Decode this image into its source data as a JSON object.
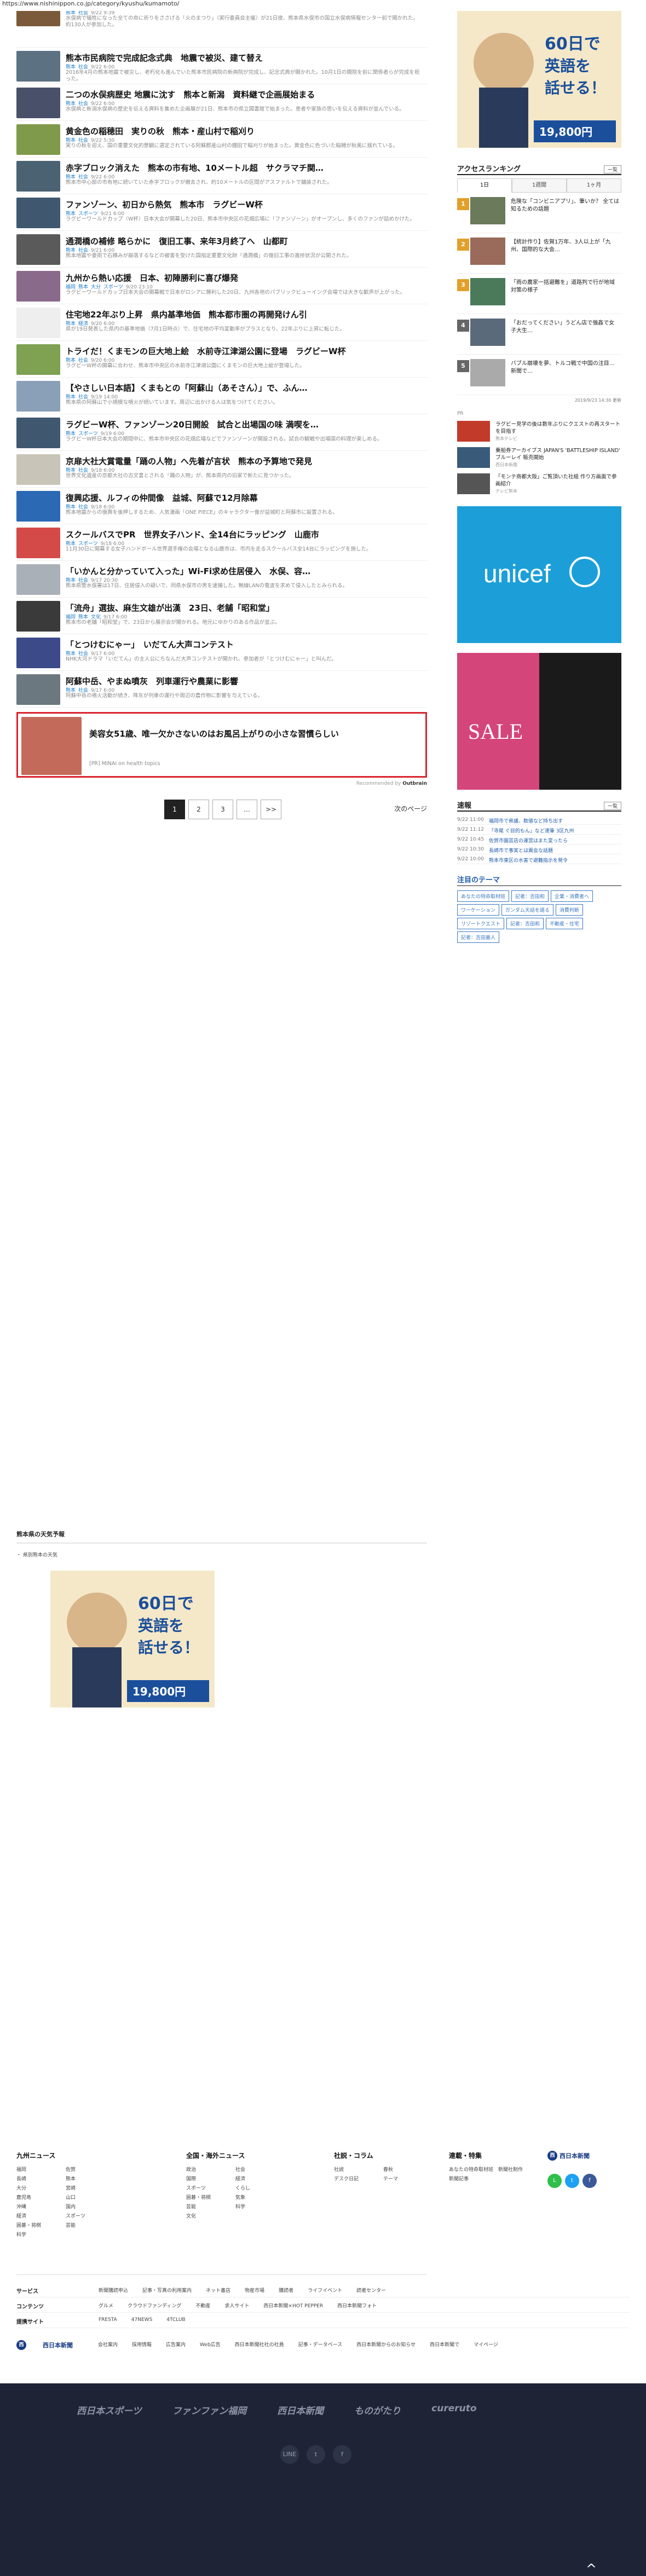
{
  "url": "https://www.nishinippon.co.jp/category/kyushu/kumamoto/",
  "articles": [
    {
      "title": "",
      "tags": [
        "熊本",
        "社会"
      ],
      "date": "9/22 9:39",
      "excerpt": "水俣病で犠牲になった全ての命に祈りをささげる「火のまつり」（実行委員会主催）が21日夜、熊本県水俣市の国立水俣病情報センター前で開かれた。約130人が参加した。",
      "color": "#7a5a3a"
    },
    {
      "title": "熊本市民病院で完成記念式典　地震で被災、建て替え",
      "tags": [
        "熊本",
        "社会"
      ],
      "date": "9/22 6:00",
      "excerpt": "2016年4月の熊本地震で被災し、老朽化も進んでいた熊本市民病院の新病院が完成し、記念式典が開かれた。10月1日の開院を前に関係者らが完成を祝った。",
      "color": "#5c7182"
    },
    {
      "title": "二つの水俣病歴史 地震に沈す　熊本と新潟　資料継で企画展始まる",
      "tags": [
        "熊本",
        "社会"
      ],
      "date": "9/22 6:00",
      "excerpt": "水俣病と新潟水俣病の歴史を伝える資料を集めた企画展が21日、熊本市の県立図書館で始まった。患者や家族の思いを伝える資料が並んでいる。",
      "color": "#49506a"
    },
    {
      "title": "黄金色の稲穂田　実りの秋　熊本・産山村で稲刈り",
      "tags": [
        "熊本",
        "社会"
      ],
      "date": "9/22 5:30",
      "excerpt": "実りの秋を迎え、国の重要文化的景観に選定されている阿蘇郡産山村の棚田で稲刈りが始まった。黄金色に色づいた稲穂が秋風に揺れている。",
      "color": "#7f9a4a"
    },
    {
      "title": "赤字ブロック消えた　熊本の市有地、10メートル超　サクラマチ関…",
      "tags": [
        "熊本",
        "社会"
      ],
      "date": "9/22 6:00",
      "excerpt": "熊本市中心部の市有地に続いていた赤字ブロックが撤去され、約10メートルの区間がアスファルトで舗装された。",
      "color": "#4b6272"
    },
    {
      "title": "ファンゾーン、初日から熱気　熊本市　ラグビーW杯",
      "tags": [
        "熊本",
        "スポーツ"
      ],
      "date": "9/21 6:00",
      "excerpt": "ラグビーワールドカップ（W杯）日本大会が開幕した20日、熊本市中央区の花畑広場に「ファンゾーン」がオープンし、多くのファンが詰めかけた。",
      "color": "#3f5870"
    },
    {
      "title": "通潤橋の補修 略らかに　復旧工事、来年3月終了へ　山都町",
      "tags": [
        "熊本",
        "社会"
      ],
      "date": "9/21 6:00",
      "excerpt": "熊本地震や豪雨で石積みが崩落するなどの被害を受けた国指定重要文化財「通潤橋」の復旧工事の進捗状況が公開された。",
      "color": "#5a5a5a"
    },
    {
      "title": "九州から熱い応援　日本、初陣勝利に喜び爆発",
      "tags": [
        "福岡",
        "熊本",
        "大分",
        "スポーツ"
      ],
      "date": "9/20 23:10",
      "excerpt": "ラグビーワールドカップ日本大会の開幕戦で日本がロシアに勝利した20日、九州各地のパブリックビューイング会場では大きな歓声が上がった。",
      "color": "#8a6a8a"
    },
    {
      "title": "住宅地22年ぶり上昇　県内基準地価　熊本都市圏の再開発けん引",
      "tags": [
        "熊本",
        "経済"
      ],
      "date": "9/20 6:00",
      "excerpt": "県が19日発表した県内の基準地価（7月1日時点）で、住宅地の平均変動率がプラスとなり、22年ぶりに上昇に転じた。",
      "color": "#eeeeee"
    },
    {
      "title": "トライだ！くまモンの巨大地上絵　水前寺江津湖公園に登場　ラグビーW杯",
      "tags": [
        "熊本",
        "社会"
      ],
      "date": "9/20 6:00",
      "excerpt": "ラグビーW杯の開幕に合わせ、熊本市中央区の水前寺江津湖公園にくまモンの巨大地上絵が登場した。",
      "color": "#7fa152"
    },
    {
      "title": "【やさしい日本語】くまもとの「阿蘇山（あそさん）」で、ふん…",
      "tags": [
        "熊本",
        "社会"
      ],
      "date": "9/19 14:00",
      "excerpt": "熊本県の阿蘇山で小規模な噴火が続いています。周辺に出かける人は気をつけてください。",
      "color": "#8a9fb8"
    },
    {
      "title": "ラグビーW杯、ファンゾーン20日開設　試合と出場国の味 満喫を…",
      "tags": [
        "熊本",
        "スポーツ"
      ],
      "date": "9/19 6:00",
      "excerpt": "ラグビーW杯日本大会の期間中に、熊本市中央区の花畑広場などでファンゾーンが開設される。試合の観戦や出場国の料理が楽しめる。",
      "color": "#3f5870"
    },
    {
      "title": "京扉大社大賞電量「踊の人物」へ先着が言状　熊本の予算地で発見",
      "tags": [
        "熊本",
        "社会"
      ],
      "date": "9/18 6:00",
      "excerpt": "世界文化遺産の京都大社の古文書とされる「踊の人物」が、熊本県内の旧家で新たに見つかった。",
      "color": "#c9c4b8"
    },
    {
      "title": "復興応援、ルフィの仲間像　益城、阿蘇で12月除幕",
      "tags": [
        "熊本",
        "社会"
      ],
      "date": "9/18 6:00",
      "excerpt": "熊本地震からの復興を後押しするため、人気漫画「ONE PIECE」のキャラクター像が益城町と阿蘇市に設置される。",
      "color": "#2b69b5"
    },
    {
      "title": "スクールバスでPR　世界女子ハンド、全14台にラッピング　山鹿市",
      "tags": [
        "熊本",
        "スポーツ"
      ],
      "date": "9/18 6:00",
      "excerpt": "11月30日に開幕する女子ハンドボール世界選手権の会場となる山鹿市は、市内を走るスクールバス全14台にラッピングを施した。",
      "color": "#d34a48"
    },
    {
      "title": "「いかんと分かっていて入った」Wi-Fi求め住居侵入　水俣、容…",
      "tags": [
        "熊本",
        "社会"
      ],
      "date": "9/17 20:30",
      "excerpt": "熊本県警水俣署は17日、住居侵入の疑いで、同県水俣市の男を逮捕した。無線LANの電波を求めて侵入したとみられる。",
      "color": "#aab0b8"
    },
    {
      "title": "「流舟」選抜、麻生文雄が出漢　23日、老舗「昭和堂」",
      "tags": [
        "福岡",
        "熊本",
        "文化"
      ],
      "date": "9/17 6:00",
      "excerpt": "熊本市の老舗「昭和堂」で、23日から展示会が開かれる。地元にゆかりのある作品が並ぶ。",
      "color": "#3a3a3a"
    },
    {
      "title": "「とつけむにゃー」　いだてん大声コンテスト",
      "tags": [
        "熊本",
        "社会"
      ],
      "date": "9/17 6:00",
      "excerpt": "NHK大河ドラマ「いだてん」の主人公にちなんだ大声コンテストが開かれ、参加者が「とつけむにゃー」と叫んだ。",
      "color": "#3d4a8a"
    },
    {
      "title": "阿蘇中岳、やまぬ噴灰　列車運行や農業に影響",
      "tags": [
        "熊本",
        "社会"
      ],
      "date": "9/17 6:00",
      "excerpt": "阿蘇中岳の噴火活動が続き、降灰が列車の運行や周辺の農作物に影響を与えている。",
      "color": "#6c7880"
    }
  ],
  "ad_article": {
    "title": "美容女51歳、唯一欠かさないのはお風呂上がりの小さな習慣らしい",
    "source": "[PR] MINAI on health topics",
    "color": "#c46a5a"
  },
  "recommended_by": "Recommended by",
  "recommended_brand": "Outbrain",
  "pagination": {
    "pages": [
      "1",
      "2",
      "3",
      "…",
      ">>"
    ],
    "next": "次のページ"
  },
  "weather": {
    "heading": "熊本県の天気予報",
    "sub": "・ 県別熊本の天気"
  },
  "sidebar": {
    "ad_text": "60日で英語を話せる！",
    "ranking_title": "アクセスランキング",
    "more": "一覧",
    "tabs": [
      "1日",
      "1週間",
      "1ヶ月"
    ],
    "ranking": [
      {
        "num": "1",
        "text": "危険な「コンビニアプリ」、筆いか？ 全ては知るための話題",
        "color": "#6b7a5a"
      },
      {
        "num": "2",
        "text": "【統計作り】佐賀1万年、3人以上が「九州、国際的な大会…",
        "color": "#9a6a5a"
      },
      {
        "num": "3",
        "text": "「雨の農家一括避難を」道路判で行が地域対策の様子",
        "color": "#4a7a5a"
      },
      {
        "num": "4",
        "text": "「おだってください」うどん店で強姦で女子大生…",
        "color": "#5a6a7a"
      },
      {
        "num": "5",
        "text": "バブル崩壊を夢、トルコ戦で中国の注目…新聞で…",
        "color": "#aaa"
      }
    ],
    "updated": "2019/9/23 14:30 更新",
    "pr_label": "PR",
    "pr_items": [
      {
        "text": "ラグビー見学の後は数年ぶりにクエストの再スタートを目指す",
        "source": "熊本テレビ",
        "color": "#c23a2a"
      },
      {
        "text": "乗船券アーカイブス JAPAN'S 'BATTLESHIP ISLAND' ブルーレイ 販売開始",
        "source": "西日本新聞",
        "color": "#3a5a7a"
      },
      {
        "text": "「モンテ商都大阪」ご覧頂いた社組 作り方画面で参画紹介",
        "source": "テレビ熊本",
        "color": "#555"
      }
    ],
    "unicef": "unicef",
    "sale_text": "SALE",
    "quick_title": "速報",
    "quick": [
      {
        "t": "9/22 11:00",
        "x": "福岡市で県議、数値など持ち出す"
      },
      {
        "t": "9/22 11:12",
        "x": "「寺尾 ぐ目的もん」など速筆 3区九州"
      },
      {
        "t": "9/22 10:45",
        "x": "佐賀市園芸店の運営はまた変ったら"
      },
      {
        "t": "9/22 10:30",
        "x": "長崎市で事実とは異会な話題"
      },
      {
        "t": "9/22 10:00",
        "x": "熊本市東区の水害で避難指示を発令"
      }
    ],
    "theme_title": "注目のテーマ",
    "themes": [
      "あなたの特命取材班",
      "記者：吉田和",
      "企業・消費者へ",
      "ワーケーション",
      "ガンダム天話を語る",
      "消費判断",
      "リゾートクエスト",
      "記者：吉田和",
      "不動産・住宅",
      "記者：吉田嘉人"
    ]
  },
  "footer": {
    "columns": [
      {
        "title": "九州ニュース",
        "items": [
          "福岡",
          "佐賀",
          "長崎",
          "熊本",
          "大分",
          "宮崎",
          "鹿児島",
          "山口",
          "沖縄",
          "国内",
          "経済",
          "スポーツ",
          "囲碁・将棋",
          "芸能",
          "科学"
        ]
      },
      {
        "title": "全国・海外ニュース",
        "items": [
          "政治",
          "社会",
          "国際",
          "経済",
          "スポーツ",
          "くらし",
          "囲碁・将棋",
          "気象",
          "芸能",
          "科学",
          "文化"
        ]
      },
      {
        "title": "社説・コラム",
        "items": [
          "社説",
          "春秋",
          "デスク日記",
          "テーマ"
        ]
      },
      {
        "title": "連載・特集",
        "items": [
          "あなたの特命取材班",
          "新聞社制作",
          "新聞記事"
        ]
      }
    ],
    "company_name": "西日本新聞",
    "services": [
      {
        "head": "サービス",
        "links": [
          "新聞購読申込",
          "記事・写真の利用案内",
          "ネット書店",
          "物産市場",
          "購読者",
          "ライフイベント",
          "読者センター"
        ]
      },
      {
        "head": "コンテンツ",
        "links": [
          "グルメ",
          "クラウドファンディング",
          "不動産",
          "求人サイト",
          "西日本新聞×HOT PEPPER",
          "西日本新聞フォト"
        ]
      },
      {
        "head": "提携サイト",
        "links": [
          "FRESTA",
          "47NEWS",
          "4TCLUB"
        ]
      }
    ],
    "bottom_links": [
      "会社案内",
      "採用情報",
      "広告案内",
      "Web広告",
      "西日本新聞社社の社員",
      "記事・データベース",
      "西日本新聞からのお知らせ",
      "西日本新聞で",
      "マイページ"
    ],
    "brands": [
      "西日本スポーツ",
      "ファンファン福岡",
      "西日本新聞",
      "ものがたり",
      "cureruto"
    ],
    "social": [
      "LINE",
      "t",
      "f"
    ],
    "top": "^"
  }
}
